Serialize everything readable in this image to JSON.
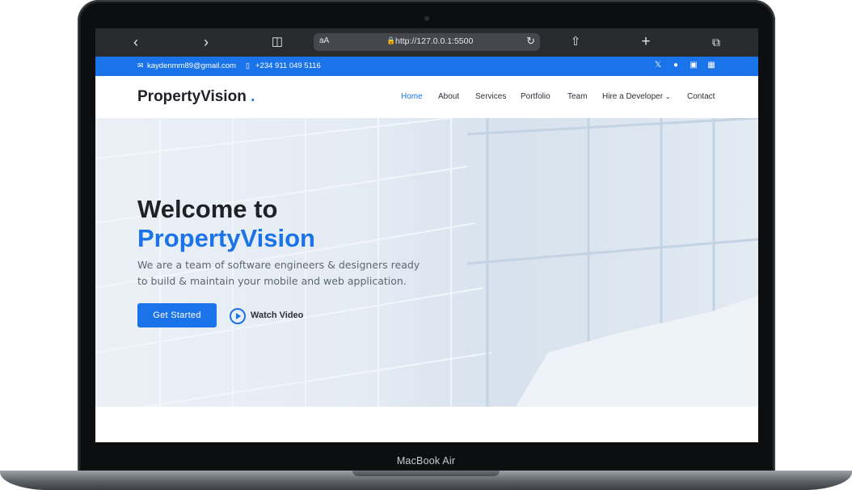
{
  "device": {
    "label": "MacBook Air"
  },
  "browser": {
    "url": "http://127.0.0.1:5500",
    "text_size_label": "aA",
    "icons": [
      "back-icon",
      "forward-icon",
      "bookmarks-icon",
      "lock-icon",
      "reload-icon",
      "share-icon",
      "new-tab-icon",
      "tabs-icon"
    ]
  },
  "topbar": {
    "email": "kaydenmm89@gmail.com",
    "phone": "+234 911 049 5116",
    "social": [
      "x-icon",
      "facebook-icon",
      "instagram-icon",
      "linkedin-icon"
    ]
  },
  "header": {
    "logo": "PropertyVision",
    "logo_dot": ".",
    "nav": [
      {
        "label": "Home",
        "active": true
      },
      {
        "label": "About"
      },
      {
        "label": "Services"
      },
      {
        "label": "Portfolio"
      },
      {
        "label": "Team"
      },
      {
        "label": "Hire a Developer"
      },
      {
        "label": "Contact"
      }
    ]
  },
  "hero": {
    "title": "Welcome to",
    "brand": "PropertyVision",
    "text": "We are a team of software engineers & designers ready to build & maintain your mobile and web application.",
    "cta": "Get Started",
    "video": "Watch Video"
  },
  "colors": {
    "accent": "#1a73e8",
    "dark": "#1f2126"
  }
}
